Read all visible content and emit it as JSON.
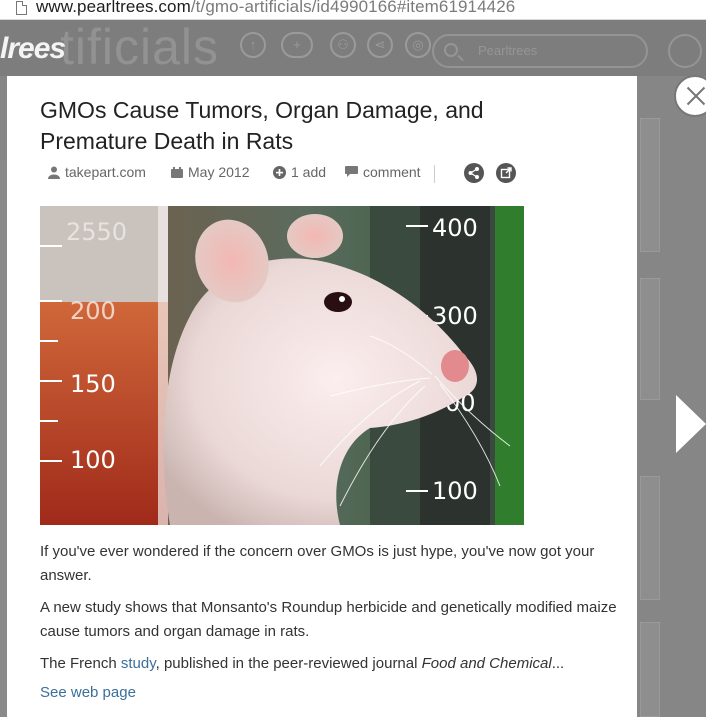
{
  "browser": {
    "url_domain": "www.pearltrees.com",
    "url_path": "/t/gmo-artificials/id4990166#item61914426"
  },
  "background": {
    "logo": "lrees",
    "collection_title": "tificials",
    "search_placeholder": "Pearltrees"
  },
  "article": {
    "title": "GMOs Cause Tumors, Organ Damage, and Premature Death in Rats",
    "meta": {
      "source": "takepart.com",
      "date": "May 2012",
      "adds": "1 add",
      "comment": "comment"
    },
    "image_alt": "Lab rat peering out from between graduated beakers",
    "beaker_left_marks": [
      "2550",
      "200",
      "150",
      "100"
    ],
    "beaker_right_marks": [
      "400",
      "300",
      "00",
      "100"
    ],
    "paragraphs": {
      "p1": "If you've ever wondered if the concern over GMOs is just hype, you've now got your answer.",
      "p2": "A new study shows that Monsanto's Roundup herbicide and genetically modified maize cause tumors and organ damage in rats.",
      "p3_prefix": "The French ",
      "p3_link": "study",
      "p3_middle": ", published in the peer-reviewed journal ",
      "p3_journal": "Food and Chemical",
      "p3_ellipsis": "..."
    },
    "see_web_page": "See web page"
  },
  "colors": {
    "link": "#3b6f9c",
    "overlay": "#868686",
    "icon_button": "#555555"
  }
}
